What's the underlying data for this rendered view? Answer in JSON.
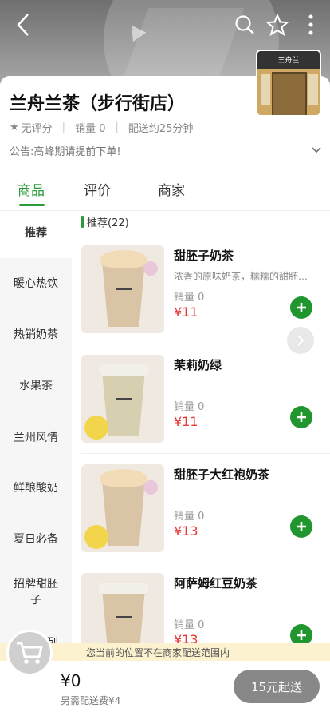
{
  "header": {
    "icons": {
      "back": "chevron-left-icon",
      "search": "search-icon",
      "favorite": "star-outline-icon",
      "more": "more-vertical-icon"
    },
    "store_thumb_sign": "三舟兰"
  },
  "store": {
    "name": "兰舟兰茶（步行街店）",
    "rating": "无评分",
    "sales": "销量 0",
    "delivery_time": "配送约25分钟",
    "notice": "公告:高峰期请提前下单!"
  },
  "tabs": [
    {
      "label": "商品",
      "active": true
    },
    {
      "label": "评价",
      "active": false
    },
    {
      "label": "商家",
      "active": false
    }
  ],
  "sidebar": {
    "items": [
      {
        "label": "推荐",
        "active": true
      },
      {
        "label": "暖心热饮"
      },
      {
        "label": "热销奶茶"
      },
      {
        "label": "水果茶"
      },
      {
        "label": "兰州风情"
      },
      {
        "label": "鲜酿酸奶"
      },
      {
        "label": "夏日必备"
      },
      {
        "label": "招牌甜胚子"
      },
      {
        "label": "套餐系列"
      }
    ]
  },
  "section": {
    "title": "推荐(22)"
  },
  "products": [
    {
      "name": "甜胚子奶茶",
      "desc": "浓香的原味奶茶，糯糯的甜胚…",
      "sales": "销量 0",
      "price": "¥11"
    },
    {
      "name": "茉莉奶绿",
      "desc": "",
      "sales": "销量 0",
      "price": "¥11"
    },
    {
      "name": "甜胚子大红袍奶茶",
      "desc": "",
      "sales": "销量 0",
      "price": "¥13"
    },
    {
      "name": "阿萨姆红豆奶茶",
      "desc": "",
      "sales": "销量 0",
      "price": "¥13"
    }
  ],
  "footer": {
    "range_notice": "您当前的位置不在商家配送范围内",
    "total": "¥0",
    "delivery_fee": "另需配送费¥4",
    "start_button": "15元起送"
  },
  "colors": {
    "accent": "#2a9a3a",
    "price": "#e53935",
    "add_button": "#21962f"
  }
}
